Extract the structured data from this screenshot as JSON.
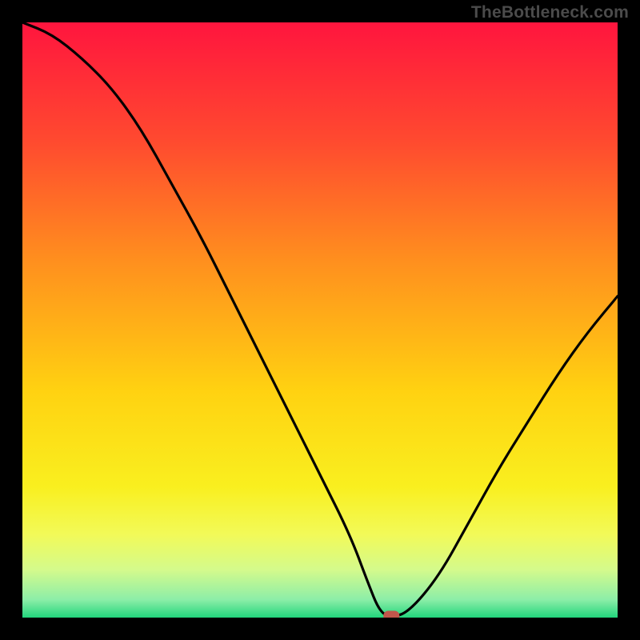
{
  "watermark": "TheBottleneck.com",
  "chart_data": {
    "type": "line",
    "title": "",
    "xlabel": "",
    "ylabel": "",
    "xlim": [
      0,
      100
    ],
    "ylim": [
      0,
      100
    ],
    "series": [
      {
        "name": "bottleneck-curve",
        "x": [
          0,
          5,
          10,
          15,
          20,
          25,
          30,
          35,
          40,
          45,
          50,
          55,
          58,
          60,
          62,
          65,
          70,
          75,
          80,
          85,
          90,
          95,
          100
        ],
        "values": [
          100,
          98,
          94,
          89,
          82,
          73,
          64,
          54,
          44,
          34,
          24,
          14,
          6,
          1,
          0,
          1,
          7,
          16,
          25,
          33,
          41,
          48,
          54
        ]
      }
    ],
    "marker": {
      "x": 62,
      "y": 0
    },
    "gradient_stops": [
      {
        "offset": 0,
        "color": "#ff153e"
      },
      {
        "offset": 20,
        "color": "#ff4a2f"
      },
      {
        "offset": 40,
        "color": "#ff8f1e"
      },
      {
        "offset": 62,
        "color": "#ffd211"
      },
      {
        "offset": 78,
        "color": "#f9ef1f"
      },
      {
        "offset": 86,
        "color": "#f2fa58"
      },
      {
        "offset": 92,
        "color": "#d4fa8c"
      },
      {
        "offset": 97,
        "color": "#8ceea8"
      },
      {
        "offset": 100,
        "color": "#22d57c"
      }
    ],
    "marker_color": "#c1574c"
  }
}
